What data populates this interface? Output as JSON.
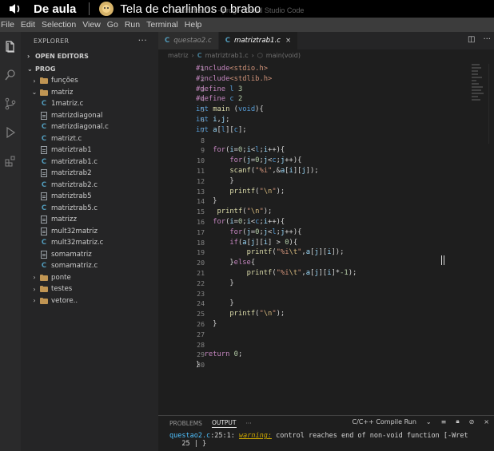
{
  "overlay": {
    "title": "De aula",
    "subtitle": "Tela de charlinhos o brabo",
    "window_title": "matriztrab1.c - prog - Visual Studio Code"
  },
  "menu": [
    "File",
    "Edit",
    "Selection",
    "View",
    "Go",
    "Run",
    "Terminal",
    "Help"
  ],
  "sidebar": {
    "header": "EXPLORER",
    "open_editors": "OPEN EDITORS",
    "root": "PROG",
    "tree": [
      {
        "type": "folder",
        "label": "funções",
        "depth": 1,
        "open": false
      },
      {
        "type": "folder",
        "label": "matriz",
        "depth": 1,
        "open": true
      },
      {
        "type": "c",
        "label": "1matriz.c",
        "depth": 2
      },
      {
        "type": "file",
        "label": "matrizdiagonal",
        "depth": 2
      },
      {
        "type": "c",
        "label": "matrizdiagonal.c",
        "depth": 2
      },
      {
        "type": "c",
        "label": "matrizt.c",
        "depth": 2
      },
      {
        "type": "file",
        "label": "matriztrab1",
        "depth": 2
      },
      {
        "type": "c",
        "label": "matriztrab1.c",
        "depth": 2
      },
      {
        "type": "file",
        "label": "matriztrab2",
        "depth": 2
      },
      {
        "type": "c",
        "label": "matriztrab2.c",
        "depth": 2
      },
      {
        "type": "file",
        "label": "matriztrab5",
        "depth": 2
      },
      {
        "type": "c",
        "label": "matriztrab5.c",
        "depth": 2
      },
      {
        "type": "file",
        "label": "matrizz",
        "depth": 2
      },
      {
        "type": "file",
        "label": "mult32matriz",
        "depth": 2
      },
      {
        "type": "c",
        "label": "mult32matriz.c",
        "depth": 2
      },
      {
        "type": "file",
        "label": "somamatriz",
        "depth": 2
      },
      {
        "type": "c",
        "label": "somamatriz.c",
        "depth": 2
      },
      {
        "type": "folder",
        "label": "ponte",
        "depth": 1,
        "open": false
      },
      {
        "type": "folder",
        "label": "testes",
        "depth": 1,
        "open": false
      },
      {
        "type": "folder",
        "label": "vetore..",
        "depth": 1,
        "open": false
      }
    ]
  },
  "tabs": [
    {
      "label": "questao2.c",
      "active": false
    },
    {
      "label": "matriztrab1.c",
      "active": true
    }
  ],
  "breadcrumb": {
    "folder": "matriz",
    "file": "matriztrab1.c",
    "symbol": "main(void)"
  },
  "code": [
    {
      "n": "1",
      "html": "<span class='tok-pp'>#include</span><span class='tok-str'>&lt;stdio.h&gt;</span>"
    },
    {
      "n": "2",
      "html": "<span class='tok-pp'>#include</span><span class='tok-str'>&lt;stdlib.h&gt;</span>"
    },
    {
      "n": "3",
      "html": "<span class='tok-pp'>#define</span> <span class='tok-kw'>l</span> <span class='tok-num'>3</span>"
    },
    {
      "n": "4",
      "html": "<span class='tok-pp'>#define</span> <span class='tok-kw'>c</span> <span class='tok-num'>2</span>"
    },
    {
      "n": "5",
      "html": "<span class='tok-kw'>int</span> <span class='tok-fn'>main</span> (<span class='tok-kw'>void</span>){"
    },
    {
      "n": "6",
      "html": "<span class='tok-kw'>int</span> <span class='tok-var'>i</span>,<span class='tok-var'>j</span>;"
    },
    {
      "n": "7",
      "html": "<span class='tok-kw'>int</span> <span class='tok-var'>a</span>[<span class='tok-kw'>l</span>][<span class='tok-kw'>c</span>];"
    },
    {
      "n": "8",
      "html": ""
    },
    {
      "n": "9",
      "html": "    <span class='tok-ctl'>for</span>(<span class='tok-var'>i</span>=<span class='tok-num'>0</span>;<span class='tok-var'>i</span>&lt;<span class='tok-kw'>l</span>;<span class='tok-var'>i</span>++){"
    },
    {
      "n": "10",
      "html": "        <span class='tok-ctl'>for</span>(<span class='tok-var'>j</span>=<span class='tok-num'>0</span>;<span class='tok-var'>j</span>&lt;<span class='tok-kw'>c</span>;<span class='tok-var'>j</span>++){"
    },
    {
      "n": "11",
      "html": "        <span class='tok-fn'>scanf</span>(<span class='tok-str'>\"%i\"</span>,&amp;<span class='tok-var'>a</span>[<span class='tok-var'>i</span>][<span class='tok-var'>j</span>]);"
    },
    {
      "n": "12",
      "html": "        }"
    },
    {
      "n": "13",
      "html": "        <span class='tok-fn'>printf</span>(<span class='tok-str'>\"</span><span class='tok-esc'>\\n</span><span class='tok-str'>\"</span>);"
    },
    {
      "n": "14",
      "html": "    }"
    },
    {
      "n": "15",
      "html": "     <span class='tok-fn'>printf</span>(<span class='tok-str'>\"</span><span class='tok-esc'>\\n</span><span class='tok-str'>\"</span>);"
    },
    {
      "n": "16",
      "html": "    <span class='tok-ctl'>for</span>(<span class='tok-var'>i</span>=<span class='tok-num'>0</span>;<span class='tok-var'>i</span>&lt;<span class='tok-kw'>c</span>;<span class='tok-var'>i</span>++){"
    },
    {
      "n": "17",
      "html": "        <span class='tok-ctl'>for</span>(<span class='tok-var'>j</span>=<span class='tok-num'>0</span>;<span class='tok-var'>j</span>&lt;<span class='tok-kw'>l</span>;<span class='tok-var'>j</span>++){"
    },
    {
      "n": "18",
      "html": "        <span class='tok-ctl'>if</span>(<span class='tok-var'>a</span>[<span class='tok-var'>j</span>][<span class='tok-var'>i</span>] &gt; <span class='tok-num'>0</span>){"
    },
    {
      "n": "19",
      "html": "            <span class='tok-fn'>printf</span>(<span class='tok-str'>\"%i</span><span class='tok-esc'>\\t</span><span class='tok-str'>\"</span>,<span class='tok-var'>a</span>[<span class='tok-var'>j</span>][<span class='tok-var'>i</span>]);"
    },
    {
      "n": "20",
      "html": "        }<span class='tok-ctl'>else</span>{"
    },
    {
      "n": "21",
      "html": "            <span class='tok-fn'>printf</span>(<span class='tok-str'>\"%i</span><span class='tok-esc'>\\t</span><span class='tok-str'>\"</span>,<span class='tok-var'>a</span>[<span class='tok-var'>j</span>][<span class='tok-var'>i</span>]*<span class='tok-num'>-1</span>);"
    },
    {
      "n": "22",
      "html": "        }"
    },
    {
      "n": "23",
      "html": ""
    },
    {
      "n": "24",
      "html": "        }"
    },
    {
      "n": "25",
      "html": "        <span class='tok-fn'>printf</span>(<span class='tok-str'>\"</span><span class='tok-esc'>\\n</span><span class='tok-str'>\"</span>);"
    },
    {
      "n": "26",
      "html": "    }"
    },
    {
      "n": "27",
      "html": ""
    },
    {
      "n": "28",
      "html": ""
    },
    {
      "n": "29",
      "html": "  <span class='tok-ctl'>return</span> <span class='tok-num'>0</span>;"
    },
    {
      "n": "30",
      "html": "}"
    }
  ],
  "panel": {
    "tabs": [
      "PROBLEMS",
      "OUTPUT",
      "···"
    ],
    "active_tab": "OUTPUT",
    "channel": "C/C++ Compile Run",
    "out_file": "questao2.c",
    "out_loc": ":25:1: ",
    "out_level": "warning:",
    "out_msg": " control reaches end of non-void function [-Wret",
    "out_line2": "   25 | }"
  },
  "colors": {
    "accent": "#007acc",
    "editor_bg": "#1e1e1e",
    "sidebar_bg": "#252526"
  }
}
